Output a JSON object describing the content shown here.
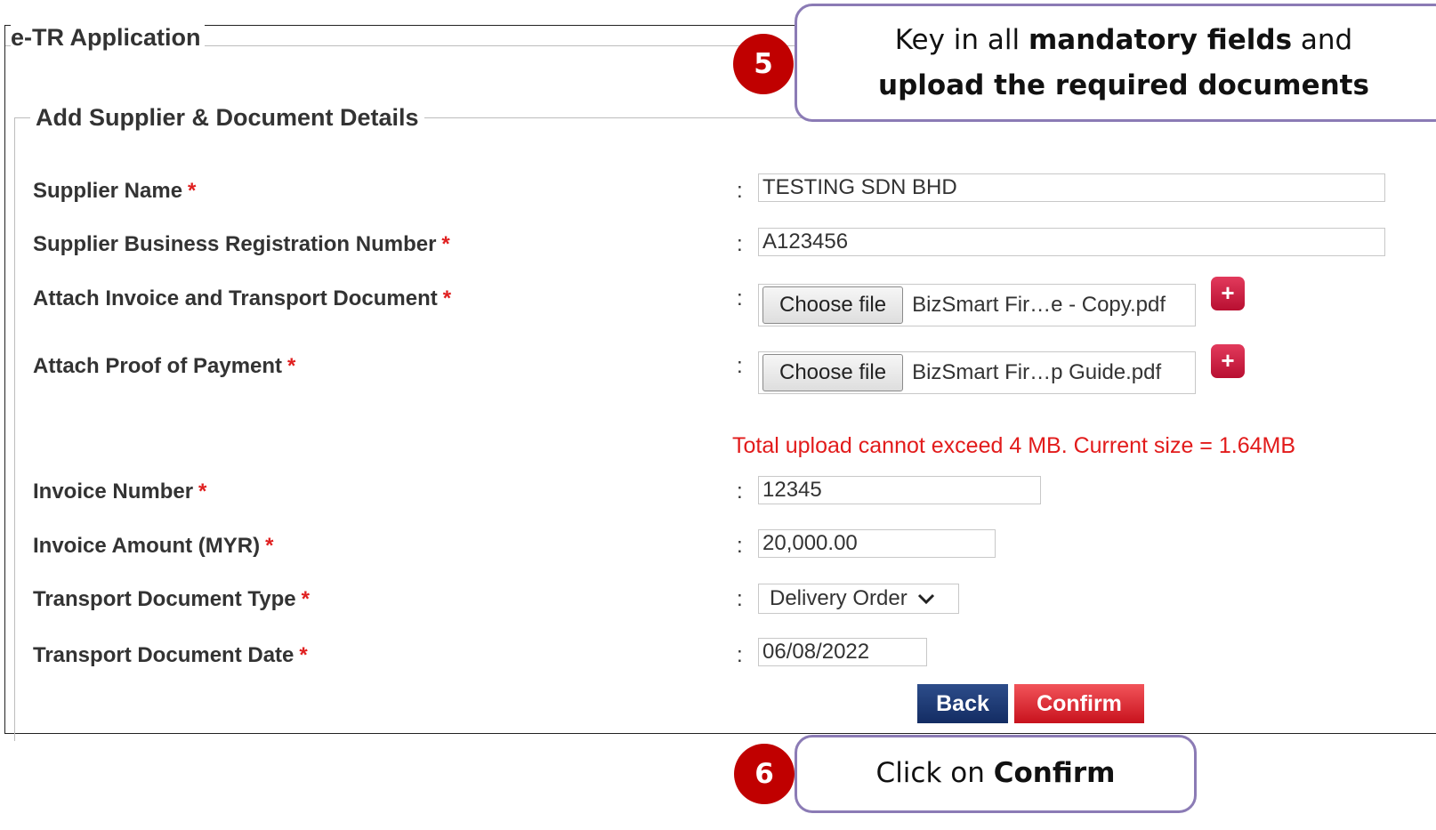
{
  "window": {
    "title": "e-TR Application"
  },
  "section": {
    "title": "Add Supplier & Document Details"
  },
  "required_mark": "*",
  "separator": ":",
  "fields": {
    "supplier_name": {
      "label": "Supplier Name",
      "value": "TESTING SDN BHD"
    },
    "supplier_brn": {
      "label": "Supplier Business Registration Number",
      "value": "A123456"
    },
    "invoice_doc": {
      "label": "Attach Invoice and Transport Document",
      "button": "Choose file",
      "file": "BizSmart Fir…e - Copy.pdf",
      "add_icon": "plus-icon"
    },
    "payment_proof": {
      "label": "Attach Proof of Payment",
      "button": "Choose file",
      "file": "BizSmart Fir…p Guide.pdf",
      "add_icon": "plus-icon"
    },
    "upload_warning": "Total upload cannot exceed 4 MB. Current size = 1.64MB",
    "invoice_number": {
      "label": "Invoice Number",
      "value": "12345"
    },
    "invoice_amount": {
      "label": "Invoice Amount (MYR)",
      "value": "20,000.00"
    },
    "transport_doc_type": {
      "label": "Transport Document Type",
      "value": "Delivery Order",
      "icon": "chevron-down-icon"
    },
    "transport_doc_date": {
      "label": "Transport Document Date",
      "value": "06/08/2022"
    }
  },
  "buttons": {
    "back": "Back",
    "confirm": "Confirm"
  },
  "annotations": {
    "step5": {
      "number": "5",
      "line1_pre": "Key in all ",
      "line1_bold": "mandatory fields",
      "line1_post": " and",
      "line2_bold": "upload the required documents"
    },
    "step6": {
      "number": "6",
      "text_pre": "Click on ",
      "text_bold": "Confirm"
    }
  },
  "colors": {
    "required": "#e02020",
    "warning": "#e21b1b",
    "back": "#1a3570",
    "confirm": "#dc1f28",
    "badge": "#c00000",
    "callout_border": "#8b7bb5"
  }
}
